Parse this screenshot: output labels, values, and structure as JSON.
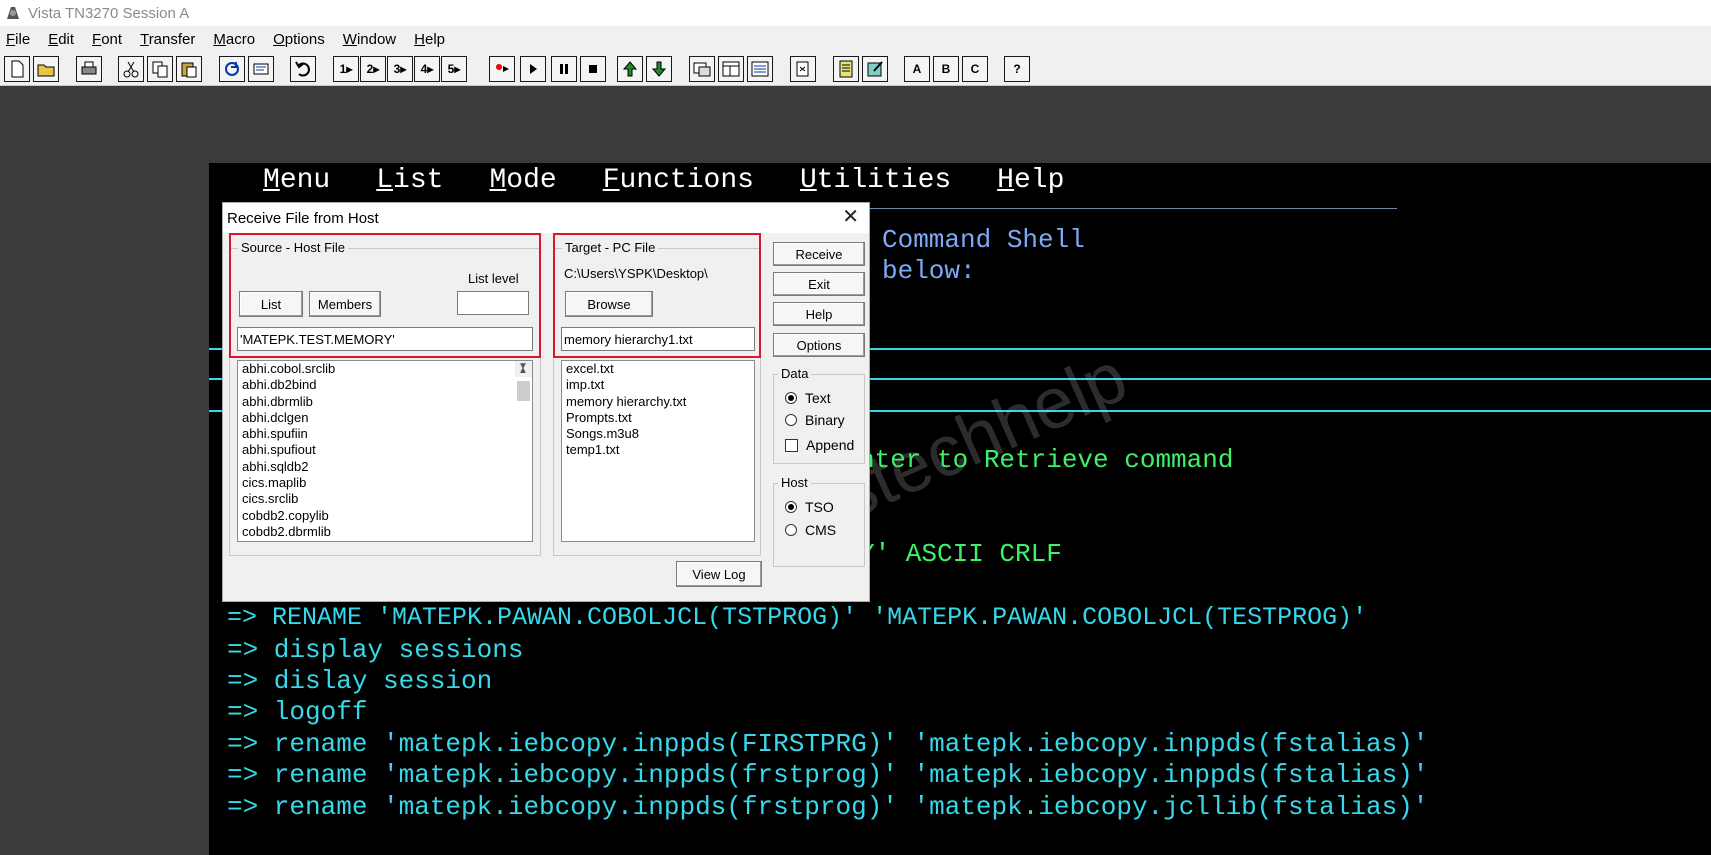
{
  "app": {
    "title": "Vista TN3270 Session A"
  },
  "menubar": [
    "File",
    "Edit",
    "Font",
    "Transfer",
    "Macro",
    "Options",
    "Window",
    "Help"
  ],
  "toolbar": {
    "macro_buttons": [
      "1",
      "2",
      "3",
      "4",
      "5"
    ],
    "letter_buttons": [
      "A",
      "B",
      "C",
      "?"
    ]
  },
  "terminal": {
    "menu": [
      "Menu",
      "List",
      "Mode",
      "Functions",
      "Utilities",
      "Help"
    ],
    "header_1": "Command Shell",
    "header_2": "below:",
    "line_retrieve": "nter to Retrieve command",
    "line_ascii": "Y' ASCII CRLF",
    "commands": [
      "=> RENAME 'MATEPK.PAWAN.COBOLJCL(TSTPROG)' 'MATEPK.PAWAN.COBOLJCL(TESTPROG)'",
      "=> display sessions",
      "=> dislay session",
      "=> logoff",
      "=> rename 'matepk.iebcopy.inppds(FIRSTPRG)' 'matepk.iebcopy.inppds(fstalias)'",
      "=> rename 'matepk.iebcopy.inppds(frstprog)' 'matepk.iebcopy.inppds(fstalias)'",
      "=> rename 'matepk.iebcopy.inppds(frstprog)' 'matepk.iebcopy.jcllib(fstalias)'"
    ],
    "watermark": "estechhelp"
  },
  "dialog": {
    "title": "Receive File from Host",
    "source": {
      "label": "Source - Host File",
      "list_level_label": "List level",
      "list_level_value": "",
      "list_button": "List",
      "members_button": "Members",
      "host_file_value": "'MATEPK.TEST.MEMORY'",
      "datasets": [
        "abhi.cobol.srclib",
        "abhi.db2bind",
        "abhi.dbrmlib",
        "abhi.dclgen",
        "abhi.spufiin",
        "abhi.spufiout",
        "abhi.sqldb2",
        "cics.maplib",
        "cics.srclib",
        "cobdb2.copylib",
        "cobdb2.dbrmlib"
      ]
    },
    "target": {
      "label": "Target - PC File",
      "path": "C:\\Users\\YSPK\\Desktop\\",
      "browse_button": "Browse",
      "file_value": "memory hierarchy1.txt",
      "files": [
        "excel.txt",
        "imp.txt",
        "memory hierarchy.txt",
        "Prompts.txt",
        "Songs.m3u8",
        "temp1.txt"
      ]
    },
    "buttons": {
      "receive": "Receive",
      "exit": "Exit",
      "help": "Help",
      "options": "Options",
      "view_log": "View Log"
    },
    "data_group": {
      "label": "Data",
      "text": "Text",
      "binary": "Binary",
      "append": "Append"
    },
    "host_group": {
      "label": "Host",
      "tso": "TSO",
      "cms": "CMS"
    }
  }
}
